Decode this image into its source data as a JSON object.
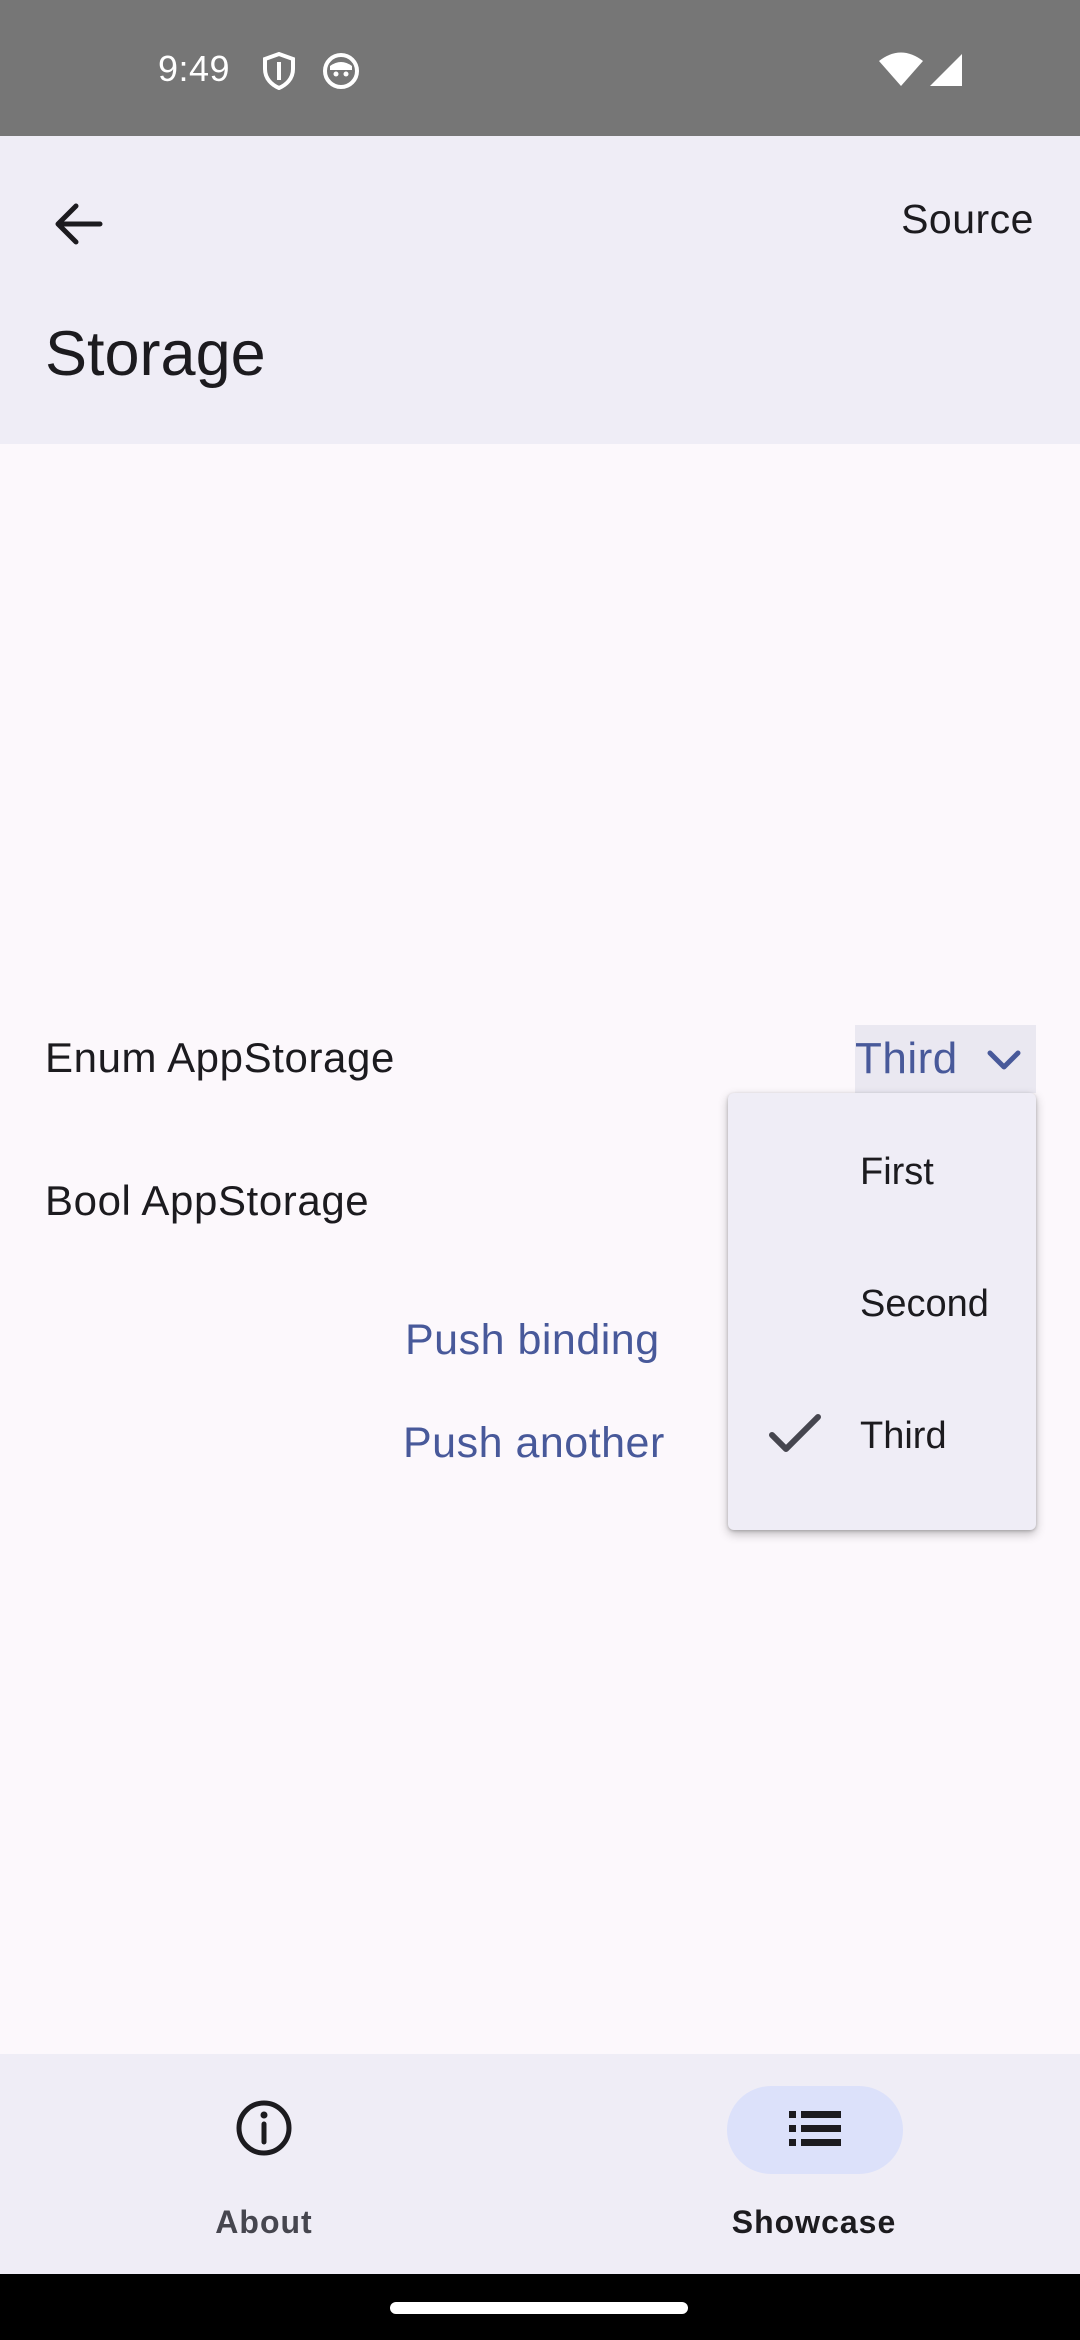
{
  "status_bar": {
    "time": "9:49",
    "icons": [
      "shield-icon",
      "face-icon",
      "wifi-icon",
      "signal-icon"
    ]
  },
  "app_bar": {
    "back_icon": "arrow-back-icon",
    "source_label": "Source",
    "title": "Storage"
  },
  "content": {
    "enum_label": "Enum AppStorage",
    "enum_value": "Third",
    "bool_label": "Bool AppStorage",
    "push_binding_label": "Push binding",
    "push_another_label": "Push another"
  },
  "dropdown": {
    "items": [
      {
        "label": "First",
        "selected": false
      },
      {
        "label": "Second",
        "selected": false
      },
      {
        "label": "Third",
        "selected": true
      }
    ]
  },
  "bottom_nav": {
    "items": [
      {
        "label": "About",
        "icon": "info-icon",
        "active": false
      },
      {
        "label": "Showcase",
        "icon": "list-icon",
        "active": true
      }
    ]
  },
  "colors": {
    "accent": "#48599a",
    "surface": "#fcf8fc",
    "container": "#efedf6",
    "active_indicator": "#dce1fa"
  }
}
